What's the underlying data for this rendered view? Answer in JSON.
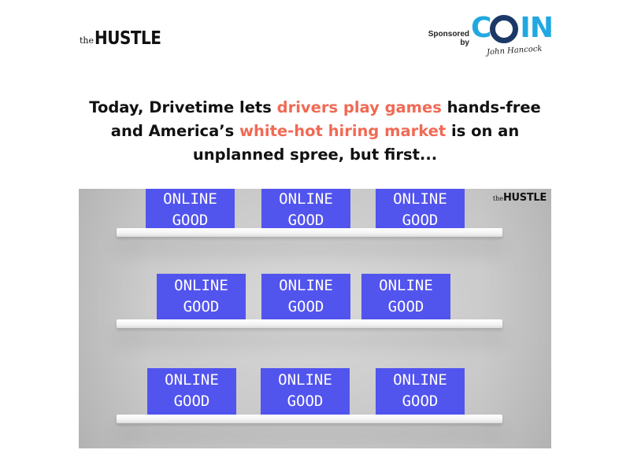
{
  "header": {
    "brand": {
      "prefix": "the",
      "name": "HUSTLE"
    },
    "sponsor": {
      "label_line1": "Sponsored",
      "label_line2": "by",
      "logo": {
        "first": "C",
        "middle": "O",
        "rest": "IN"
      },
      "signature": "John Hancock",
      "colors": {
        "coin_text": "#22a8e0",
        "coin_ring": "#1c3866"
      }
    }
  },
  "headline": {
    "parts": [
      {
        "text": "Today, Drivetime lets ",
        "highlight": false
      },
      {
        "text": "drivers play games",
        "highlight": true
      },
      {
        "text": " hands-free and America’s ",
        "highlight": false
      },
      {
        "text": "white-hot hiring market",
        "highlight": true
      },
      {
        "text": " is on an unplanned spree, but first...",
        "highlight": false
      }
    ],
    "highlight_color": "#f06a55"
  },
  "hero_image": {
    "watermark": {
      "prefix": "the",
      "name": "HUSTLE"
    },
    "product_color": "#5254ee",
    "shelves": [
      {
        "products": [
          {
            "line1": "ONLINE",
            "line2": "GOOD"
          },
          {
            "line1": "ONLINE",
            "line2": "GOOD"
          },
          {
            "line1": "ONLINE",
            "line2": "GOOD"
          }
        ]
      },
      {
        "products": [
          {
            "line1": "ONLINE",
            "line2": "GOOD"
          },
          {
            "line1": "ONLINE",
            "line2": "GOOD"
          },
          {
            "line1": "ONLINE",
            "line2": "GOOD"
          }
        ]
      },
      {
        "products": [
          {
            "line1": "ONLINE",
            "line2": "GOOD"
          },
          {
            "line1": "ONLINE",
            "line2": "GOOD"
          },
          {
            "line1": "ONLINE",
            "line2": "GOOD"
          }
        ]
      }
    ]
  }
}
